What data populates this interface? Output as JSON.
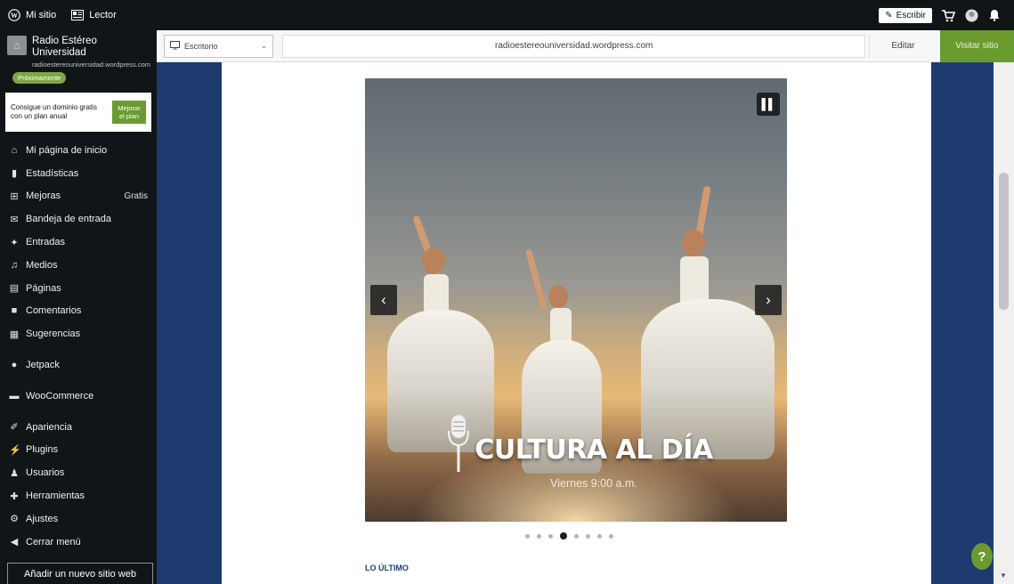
{
  "masterbar": {
    "my_site": "Mi sitio",
    "reader": "Lector",
    "write": "Escribir"
  },
  "site": {
    "title": "Radio Estéreo Universidad",
    "url": "radioestereouniversidad.wordpress.com",
    "badge": "Próximamente"
  },
  "upsell": {
    "text": "Consigue un dominio gratis con un plan anual",
    "button": "Mejorar el plan"
  },
  "nav": [
    {
      "label": "Mi página de inicio",
      "icon": "home-icon"
    },
    {
      "label": "Estadísticas",
      "icon": "stats-icon"
    },
    {
      "label": "Mejoras",
      "icon": "cart-icon",
      "badge": "Gratis"
    },
    {
      "label": "Bandeja de entrada",
      "icon": "inbox-icon"
    },
    {
      "label": "Entradas",
      "icon": "pin-icon"
    },
    {
      "label": "Medios",
      "icon": "media-icon"
    },
    {
      "label": "Páginas",
      "icon": "pages-icon"
    },
    {
      "label": "Comentarios",
      "icon": "comment-icon"
    },
    {
      "label": "Sugerencias",
      "icon": "feedback-icon"
    },
    {
      "label": "Jetpack",
      "icon": "jetpack-icon"
    },
    {
      "label": "WooCommerce",
      "icon": "woocommerce-icon"
    },
    {
      "label": "Apariencia",
      "icon": "brush-icon"
    },
    {
      "label": "Plugins",
      "icon": "plugin-icon"
    },
    {
      "label": "Usuarios",
      "icon": "user-icon"
    },
    {
      "label": "Herramientas",
      "icon": "wrench-icon"
    },
    {
      "label": "Ajustes",
      "icon": "settings-icon"
    },
    {
      "label": "Cerrar menú",
      "icon": "collapse-icon"
    }
  ],
  "add_site": "Añadir un nuevo sitio web",
  "preview_toolbar": {
    "device": "Escritorio",
    "url": "radioestereouniversidad.wordpress.com",
    "edit": "Editar",
    "visit": "Visitar sitio"
  },
  "slider": {
    "title": "CULTURA AL DÍA",
    "subtitle": "Viernes 9:00 a.m.",
    "dot_count": 8,
    "active_dot": 3
  },
  "latest": "LO ÚLTIMO",
  "help": "?",
  "colors": {
    "masterbar": "#101517",
    "accent": "#6b9a2f",
    "theme_blue": "#1d3b6e"
  }
}
